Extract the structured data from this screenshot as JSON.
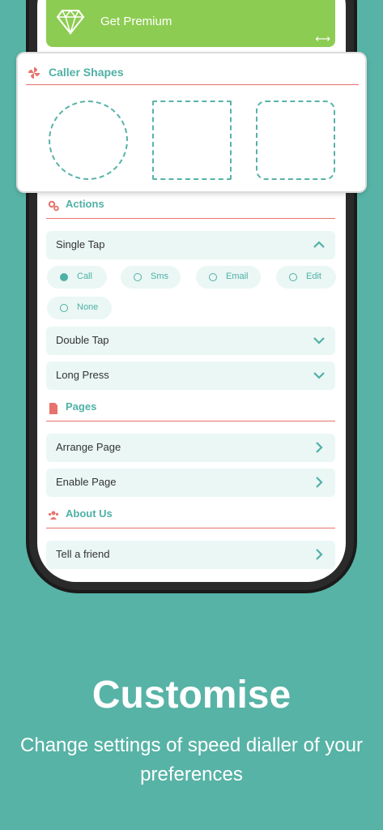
{
  "premium": {
    "label": "Get Premium",
    "arrow": "⟷"
  },
  "caller_shapes": {
    "title": "Caller Shapes",
    "shapes": [
      "circle-shape",
      "square-shape",
      "rounded-square-shape"
    ]
  },
  "actions": {
    "title": "Actions",
    "single_tap": "Single Tap",
    "options": [
      "Call",
      "Sms",
      "Email",
      "Edit",
      "None"
    ],
    "selected": "Call",
    "double_tap": "Double Tap",
    "long_press": "Long Press"
  },
  "pages": {
    "title": "Pages",
    "arrange": "Arrange Page",
    "enable": "Enable Page"
  },
  "about": {
    "title": "About Us",
    "tell_friend": "Tell a friend"
  },
  "promo": {
    "title": "Customise",
    "subtitle": "Change settings of speed dialler of your preferences"
  },
  "colors": {
    "teal": "#57b3a6",
    "green": "#8dcc52",
    "red": "#e8726b",
    "row_bg": "#eaf7f5"
  }
}
